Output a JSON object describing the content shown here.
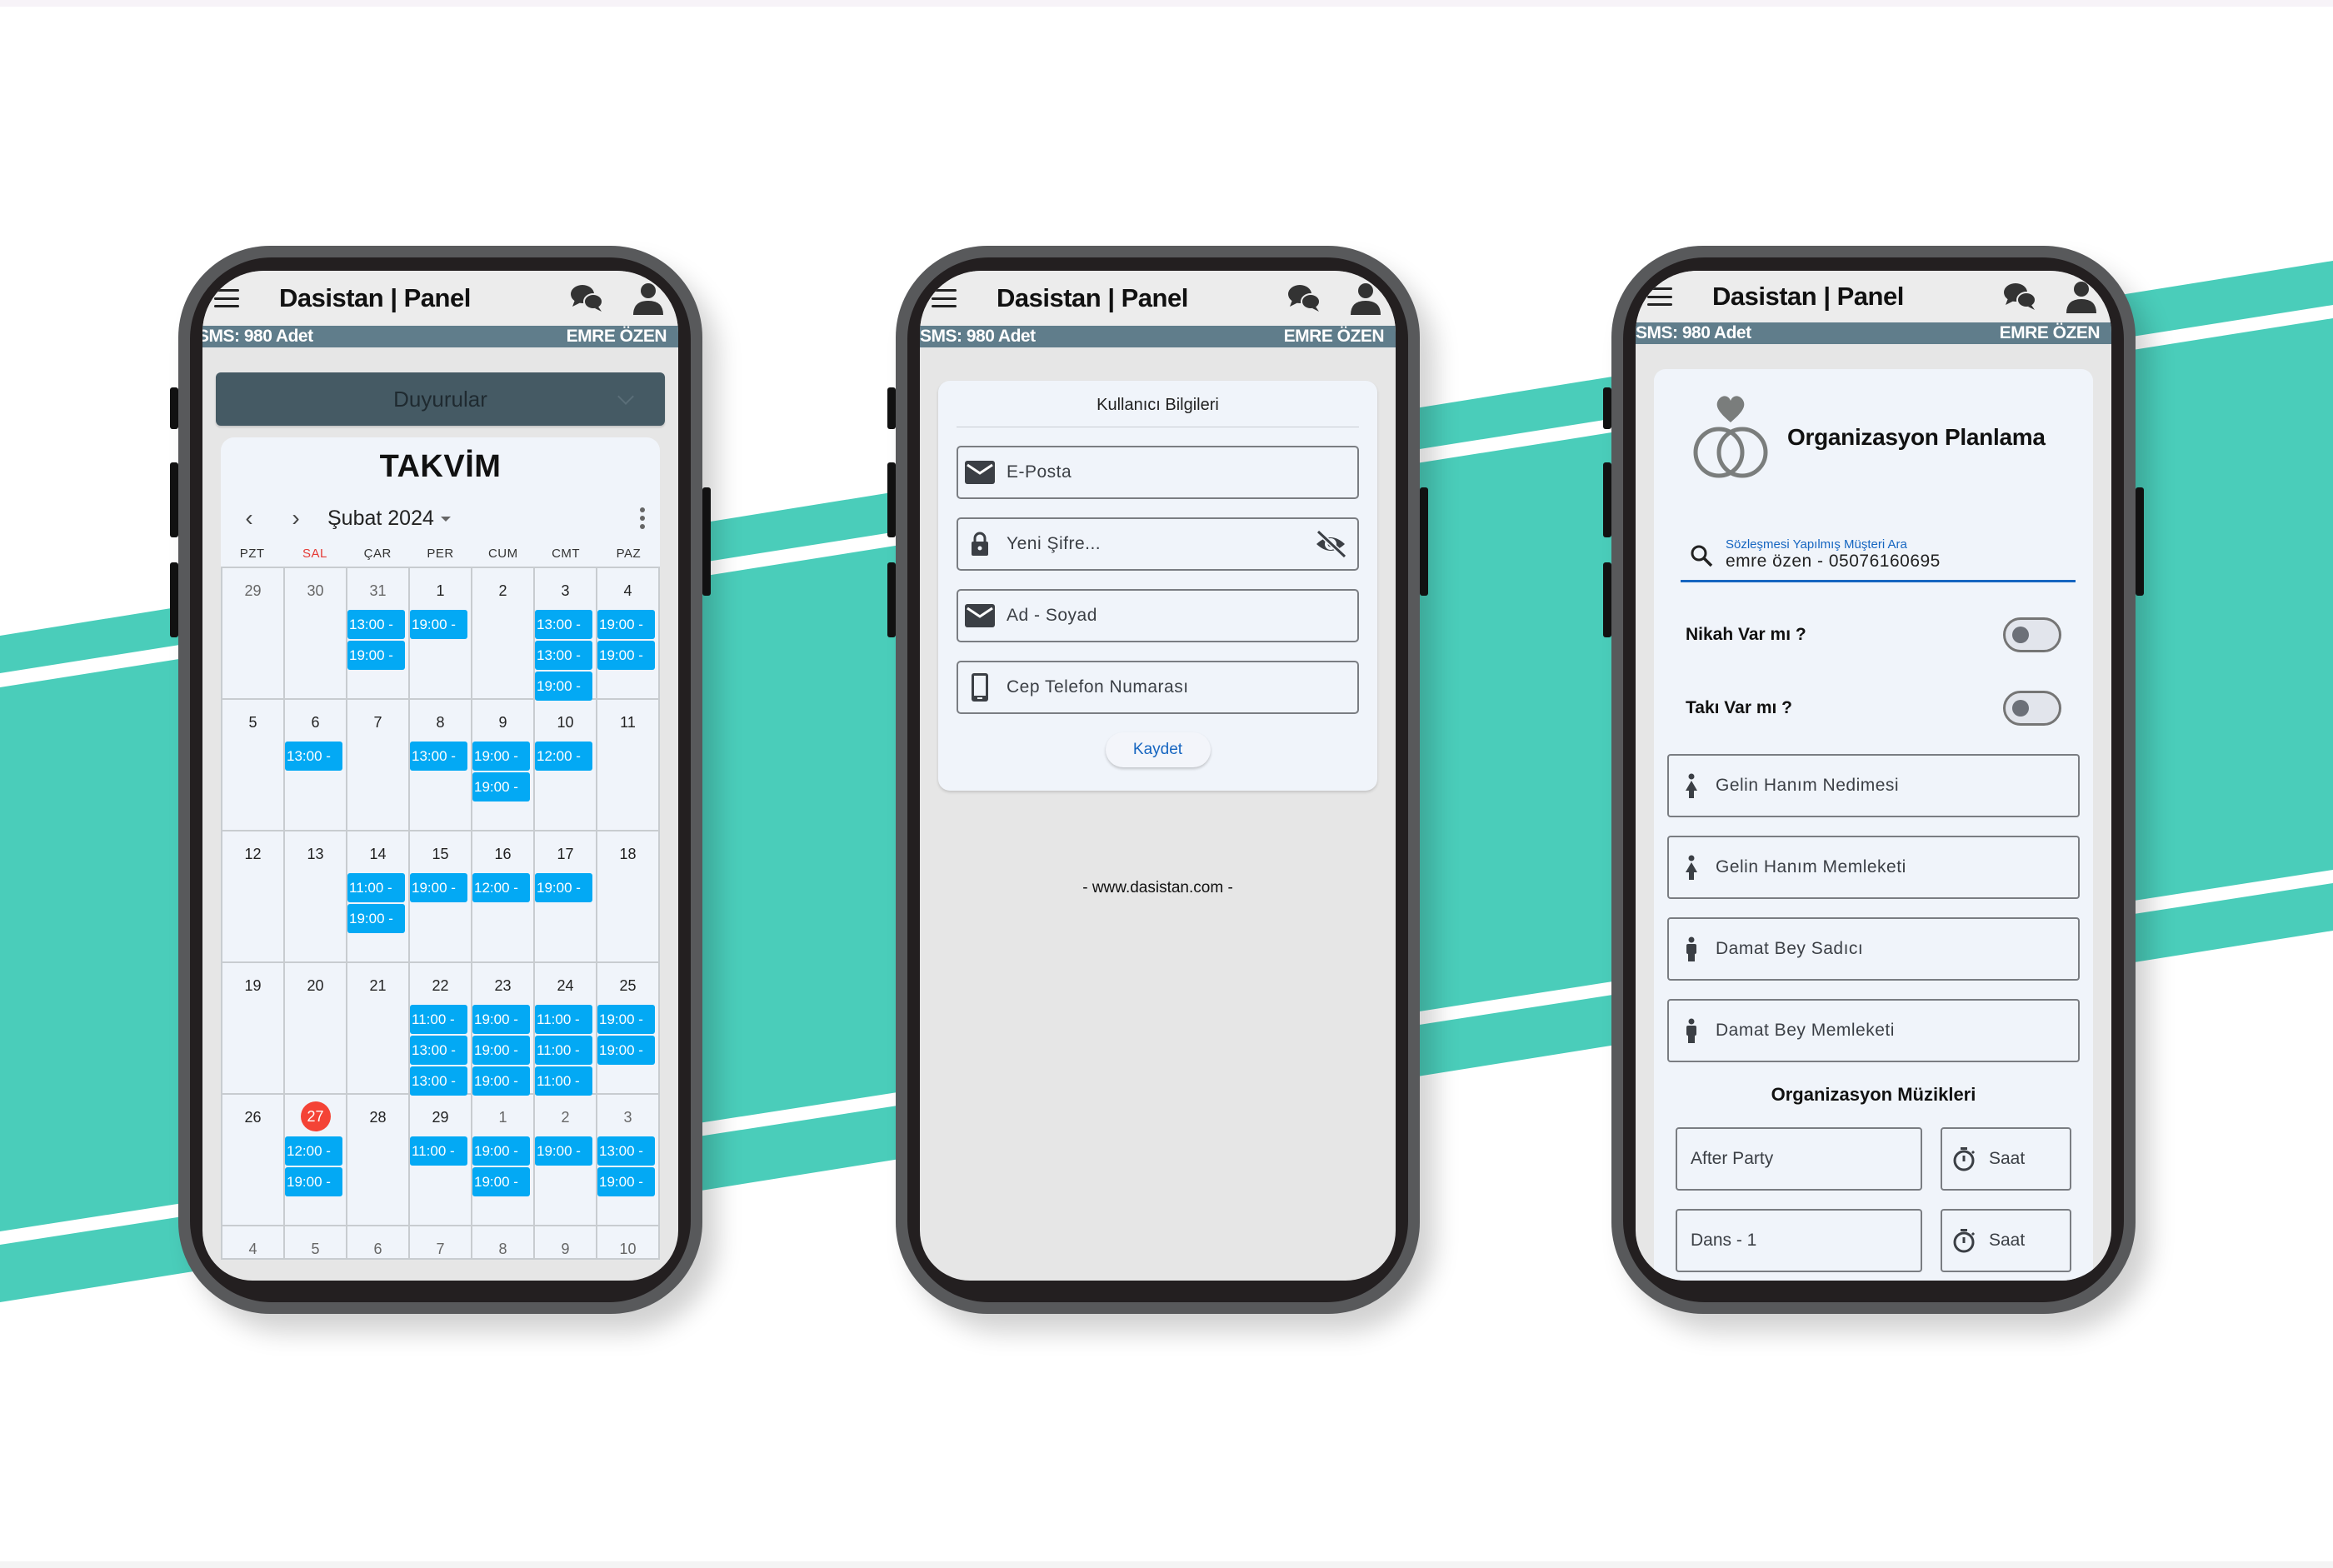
{
  "theme": {
    "accent_teal": "#4ACDBA",
    "event_blue": "#03A9F4",
    "info_bar": "#607D8B",
    "today_red": "#F44336",
    "link_blue": "#1565C0"
  },
  "common": {
    "app_title": "Dasistan | Panel",
    "sms_label": "SMS: 980 Adet",
    "user_name": "EMRE ÖZEN",
    "icons": {
      "menu": "hamburger-icon",
      "chat": "chat-bubbles-icon",
      "user": "user-icon"
    }
  },
  "calendar_screen": {
    "announcements_label": "Duyurular",
    "calendar_title": "TAKVİM",
    "month_label": "Şubat 2024",
    "weekdays": [
      "PZT",
      "SAL",
      "ÇAR",
      "PER",
      "CUM",
      "CMT",
      "PAZ"
    ],
    "weeks": [
      [
        {
          "day": "29",
          "muted": true,
          "events": []
        },
        {
          "day": "30",
          "muted": true,
          "events": []
        },
        {
          "day": "31",
          "muted": true,
          "events": [
            "13:00 -",
            "19:00 -"
          ]
        },
        {
          "day": "1",
          "events": [
            "19:00 -"
          ]
        },
        {
          "day": "2",
          "events": []
        },
        {
          "day": "3",
          "events": [
            "13:00 -",
            "13:00 -",
            "19:00 -"
          ]
        },
        {
          "day": "4",
          "events": [
            "19:00 -",
            "19:00 -"
          ]
        }
      ],
      [
        {
          "day": "5",
          "events": []
        },
        {
          "day": "6",
          "events": [
            "13:00 -"
          ]
        },
        {
          "day": "7",
          "events": []
        },
        {
          "day": "8",
          "events": [
            "13:00 -"
          ]
        },
        {
          "day": "9",
          "events": [
            "19:00 -",
            "19:00 -"
          ]
        },
        {
          "day": "10",
          "events": [
            "12:00 -"
          ]
        },
        {
          "day": "11",
          "events": []
        }
      ],
      [
        {
          "day": "12",
          "events": []
        },
        {
          "day": "13",
          "events": []
        },
        {
          "day": "14",
          "events": [
            "11:00 -",
            "19:00 -"
          ]
        },
        {
          "day": "15",
          "events": [
            "19:00 -"
          ]
        },
        {
          "day": "16",
          "events": [
            "12:00 -"
          ]
        },
        {
          "day": "17",
          "events": [
            "19:00 -"
          ]
        },
        {
          "day": "18",
          "events": []
        }
      ],
      [
        {
          "day": "19",
          "events": []
        },
        {
          "day": "20",
          "events": []
        },
        {
          "day": "21",
          "events": []
        },
        {
          "day": "22",
          "events": [
            "11:00 -",
            "13:00 -",
            "13:00 -"
          ]
        },
        {
          "day": "23",
          "events": [
            "19:00 -",
            "19:00 -",
            "19:00 -"
          ]
        },
        {
          "day": "24",
          "events": [
            "11:00 -",
            "11:00 -",
            "11:00 -"
          ]
        },
        {
          "day": "25",
          "events": [
            "19:00 -",
            "19:00 -"
          ]
        }
      ],
      [
        {
          "day": "26",
          "events": []
        },
        {
          "day": "27",
          "today": true,
          "events": [
            "12:00 -",
            "19:00 -"
          ]
        },
        {
          "day": "28",
          "events": []
        },
        {
          "day": "29",
          "events": [
            "11:00 -"
          ]
        },
        {
          "day": "1",
          "muted": true,
          "events": [
            "19:00 -",
            "19:00 -"
          ]
        },
        {
          "day": "2",
          "muted": true,
          "events": [
            "19:00 -"
          ]
        },
        {
          "day": "3",
          "muted": true,
          "events": [
            "13:00 -",
            "19:00 -"
          ]
        }
      ],
      [
        {
          "day": "4",
          "muted": true,
          "events": []
        },
        {
          "day": "5",
          "muted": true,
          "events": []
        },
        {
          "day": "6",
          "muted": true,
          "events": []
        },
        {
          "day": "7",
          "muted": true,
          "events": []
        },
        {
          "day": "8",
          "muted": true,
          "events": []
        },
        {
          "day": "9",
          "muted": true,
          "events": []
        },
        {
          "day": "10",
          "muted": true,
          "events": []
        }
      ]
    ]
  },
  "profile_screen": {
    "card_title": "Kullanıcı Bilgileri",
    "fields": [
      {
        "placeholder": "E-Posta",
        "icon": "email-icon",
        "value": ""
      },
      {
        "placeholder": "Yeni Şifre...",
        "icon": "lock-icon",
        "value": "",
        "trailing_icon": "visibility-off-icon"
      },
      {
        "placeholder": "Ad - Soyad",
        "icon": "email-icon",
        "value": ""
      },
      {
        "placeholder": "Cep Telefon Numarası",
        "icon": "smartphone-icon",
        "value": ""
      }
    ],
    "save_label": "Kaydet",
    "footer_link": "- www.dasistan.com -"
  },
  "organization_screen": {
    "title": "Organizasyon Planlama",
    "search_label": "Sözleşmesi Yapılmış Müşteri Ara",
    "search_value": "emre özen - 05076160695",
    "toggles": [
      {
        "label": "Nikah Var mı ?",
        "on": false
      },
      {
        "label": "Takı Var mı ?",
        "on": false
      }
    ],
    "person_fields": [
      {
        "placeholder": "Gelin Hanım Nedimesi",
        "icon": "woman-icon"
      },
      {
        "placeholder": "Gelin Hanım Memleketi",
        "icon": "woman-icon"
      },
      {
        "placeholder": "Damat Bey Sadıcı",
        "icon": "man-icon"
      },
      {
        "placeholder": "Damat Bey Memleketi",
        "icon": "man-icon"
      }
    ],
    "music_title": "Organizasyon Müzikleri",
    "music_rows": [
      {
        "name": "After Party",
        "time_placeholder": "Saat"
      },
      {
        "name": "Dans - 1",
        "time_placeholder": "Saat"
      }
    ]
  }
}
